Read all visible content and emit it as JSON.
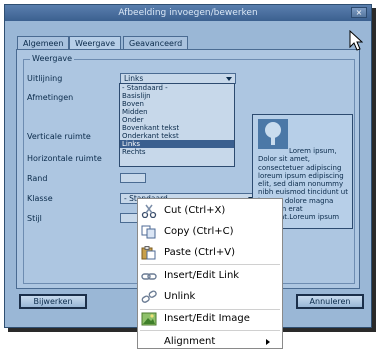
{
  "dialog": {
    "title": "Afbeelding invoegen/bewerken",
    "close_glyph": "×",
    "tabs": [
      {
        "label": "Algemeen",
        "active": false
      },
      {
        "label": "Weergave",
        "active": true
      },
      {
        "label": "Geavanceerd",
        "active": false
      }
    ],
    "legend": "Weergave",
    "labels": {
      "uitlijning": "Uitlijning",
      "afmetingen": "Afmetingen",
      "verticale_ruimte": "Verticale ruimte",
      "horizontale_ruimte": "Horizontale ruimte",
      "rand": "Rand",
      "klasse": "Klasse",
      "stijl": "Stijl"
    },
    "uitlijning_value": "Links",
    "uitlijning_options": [
      "- Standaard -",
      "Basislijn",
      "Boven",
      "Midden",
      "Onder",
      "Bovenkant tekst",
      "Onderkant tekst",
      "Links",
      "Rechts"
    ],
    "uitlijning_selected_index": 7,
    "klasse_value": "- Standaard -",
    "preview_text": "Lorem ipsum, Dolor sit amet, consectetuer adipiscing loreum ipsum edipiscing elit, sed diam nonummy nibh euismod tincidunt ut laoreet dolore magna aliquam erat volutpat.Loreum ipsum",
    "buttons": {
      "update": "Bijwerken",
      "cancel": "Annuleren"
    }
  },
  "context_menu": {
    "items": [
      {
        "label": "Cut (Ctrl+X)",
        "icon": "scissors-icon"
      },
      {
        "label": "Copy (Ctrl+C)",
        "icon": "copy-icon"
      },
      {
        "label": "Paste (Ctrl+V)",
        "icon": "paste-icon"
      },
      {
        "label": "Insert/Edit Link",
        "icon": "link-icon"
      },
      {
        "label": "Unlink",
        "icon": "unlink-icon"
      },
      {
        "label": "Insert/Edit Image",
        "icon": "image-icon"
      },
      {
        "label": "Alignment",
        "icon": "none",
        "submenu": true
      }
    ]
  },
  "colors": {
    "dialog_bg": "#9ab7d6",
    "titlebar": "#3b608f",
    "selection": "#3a5f8f"
  }
}
